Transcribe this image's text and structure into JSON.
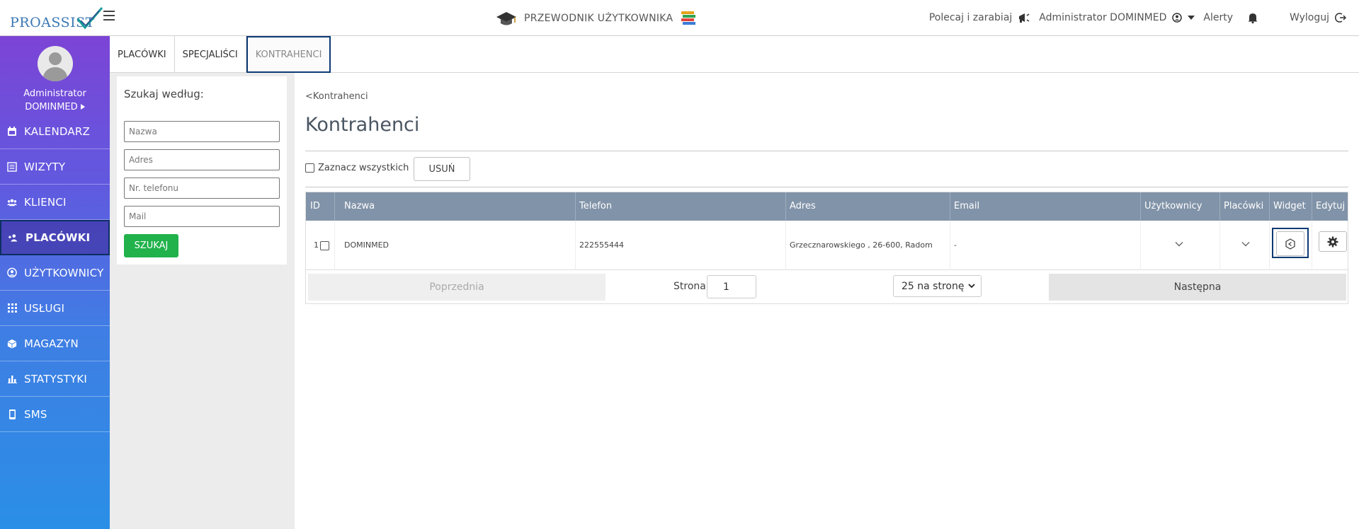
{
  "app": {
    "logo_text": "PROASSIST",
    "guide_label": "PRZEWODNIK UŻYTKOWNIKA",
    "refer_label": "Polecaj i zarabiaj",
    "account_label": "Administrator DOMINMED",
    "alerts_label": "Alerty",
    "logout_label": "Wyloguj"
  },
  "sidebar": {
    "user_line1": "Administrator",
    "user_line2": "DOMINMED",
    "items": [
      {
        "label": "KALENDARZ",
        "icon": "calendar-icon"
      },
      {
        "label": "WIZYTY",
        "icon": "list-icon"
      },
      {
        "label": "KLIENCI",
        "icon": "users-icon"
      },
      {
        "label": "PLACÓWKI",
        "icon": "user-plus-icon",
        "active": true
      },
      {
        "label": "UŻYTKOWNICY",
        "icon": "user-circle-icon"
      },
      {
        "label": "USŁUGI",
        "icon": "grid-icon"
      },
      {
        "label": "MAGAZYN",
        "icon": "box-icon"
      },
      {
        "label": "STATYSTYKI",
        "icon": "bar-chart-icon"
      },
      {
        "label": "SMS",
        "icon": "phone-icon"
      }
    ]
  },
  "tabs": [
    {
      "label": "PLACÓWKI"
    },
    {
      "label": "SPECJALIŚCI"
    },
    {
      "label": "KONTRAHENCI",
      "active": true
    }
  ],
  "search": {
    "title": "Szukaj według:",
    "name_placeholder": "Nazwa",
    "address_placeholder": "Adres",
    "phone_placeholder": "Nr. telefonu",
    "mail_placeholder": "Mail",
    "button_label": "SZUKAJ"
  },
  "main": {
    "breadcrumb": "<Kontrahenci",
    "title": "Kontrahenci",
    "select_all_label": "Zaznacz wszystkich",
    "delete_label": "USUŃ"
  },
  "table": {
    "columns": [
      "ID",
      "Nazwa",
      "Telefon",
      "Adres",
      "Email",
      "Użytkownicy",
      "Placówki",
      "Widget",
      "Edytuj"
    ],
    "rows": [
      {
        "id": "1",
        "name": "DOMINMED",
        "phone": "222555444",
        "address": "Grzecznarowskiego , 26-600, Radom",
        "email": "-"
      }
    ]
  },
  "pager": {
    "prev_label": "Poprzednia",
    "page_label": "Strona",
    "page_value": "1",
    "per_page": "25 na stronę",
    "next_label": "Następna"
  },
  "colors": {
    "header_row": "#8193a8",
    "search_button": "#21b24b",
    "focus_outline": "#0c3a73"
  }
}
